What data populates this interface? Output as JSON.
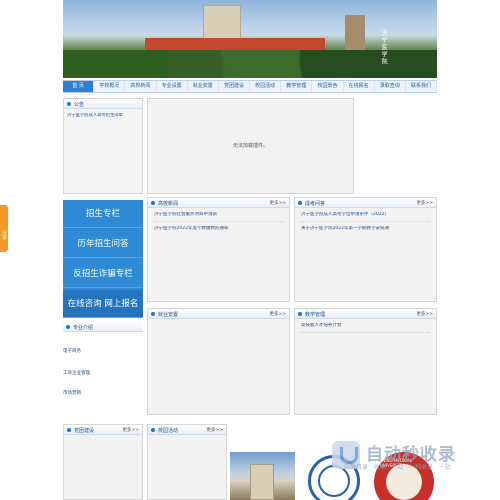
{
  "banner": {
    "calligraphy": "济宁医学院"
  },
  "nav": {
    "items": [
      "首 页",
      "学校概况",
      "高校新闻",
      "专业设置",
      "就业安置",
      "党团建设",
      "校园活动",
      "教学管理",
      "校园景色",
      "在线报名",
      "录取查询",
      "联系我们"
    ]
  },
  "notice": {
    "title": "公告",
    "items": [
      "济宁医学院成人高考招生简章"
    ]
  },
  "video": {
    "message": "无法加载插件。"
  },
  "tiles": [
    "招生专栏",
    "历年招生问答",
    "反招生诈骗专栏",
    "在线咨询    网上报名"
  ],
  "news": {
    "title": "高校新闻",
    "more": "更多>>",
    "items": [
      "济宁医学院社会服务项目申请表",
      "济宁医学院2022年度学费缴费的通知"
    ]
  },
  "qa": {
    "title": "成考问答",
    "more": "更多>>",
    "items": [
      "济宁医学院成人高考学位申请条件（2022）",
      "关于济宁医学院2022年第一学期教学安排通"
    ]
  },
  "jy": {
    "title": "就业安置",
    "more": "更多>>"
  },
  "jx": {
    "title": "教学管理",
    "more": "更多>>",
    "items": [
      "高技能人才培养计划"
    ]
  },
  "zy": {
    "title": "专业介绍",
    "items": [
      "电子商务",
      "工商企业管理",
      "市场营销"
    ]
  },
  "dj": {
    "title": "党团建设",
    "more": "更多>>"
  },
  "xy": {
    "title": "校园活动",
    "more": "更多>>"
  },
  "share": "分享",
  "watermark": {
    "brand": "自动秒收录",
    "sub": "网站目录 · 收录 · 一站 · 一秒收录 · 一站"
  },
  "photo3_text": "JINING MEDICAL UNIVERSITY",
  "colors": {
    "nav_active": "#2a7fd0",
    "tiles": "#2f8ad6",
    "share": "#f39a2a"
  }
}
